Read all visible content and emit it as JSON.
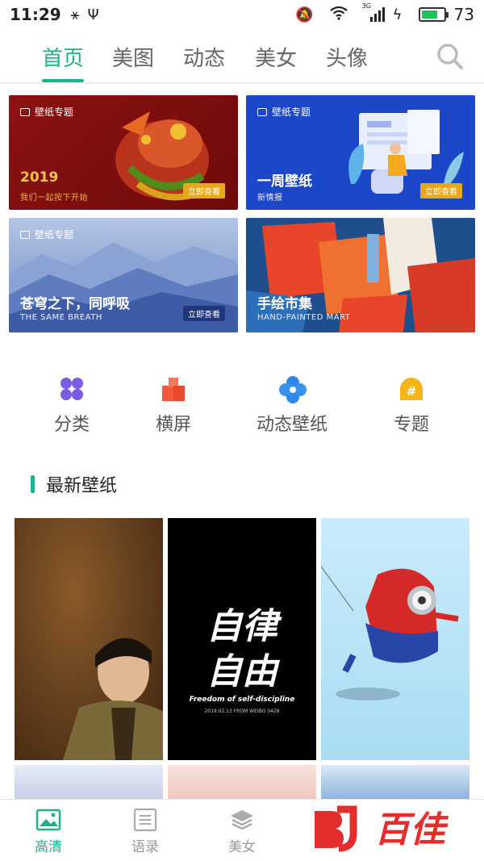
{
  "status_bar": {
    "time": "11:29",
    "network": "3G",
    "battery": "73",
    "battery_level": 0.73
  },
  "top_tabs": [
    {
      "label": "首页",
      "active": true
    },
    {
      "label": "美图",
      "active": false
    },
    {
      "label": "动态",
      "active": false
    },
    {
      "label": "美女",
      "active": false
    },
    {
      "label": "头像",
      "active": false
    }
  ],
  "banners": [
    {
      "tag": "壁纸专题",
      "title": "2019",
      "subtitle": "我们一起按下开始",
      "button": "立即查看"
    },
    {
      "tag": "壁纸专题",
      "title": "一周壁纸",
      "subtitle": "新情报",
      "button": "立即查看"
    },
    {
      "tag": "壁纸专题",
      "title": "苍穹之下，同呼吸",
      "subtitle": "THE SAME BREATH",
      "button": "立即查看"
    },
    {
      "title": "手绘市集",
      "subtitle": "HAND-PAINTED MART"
    }
  ],
  "categories": [
    {
      "label": "分类",
      "icon": "grid-icon",
      "color": "#7b5be0"
    },
    {
      "label": "横屏",
      "icon": "landscape-icon",
      "color": "#f05a3a"
    },
    {
      "label": "动态壁纸",
      "icon": "flower-icon",
      "color": "#2f86e8"
    },
    {
      "label": "专题",
      "icon": "hashtag-icon",
      "color": "#f5b518"
    }
  ],
  "section": {
    "title": "最新壁纸"
  },
  "wallpapers": [
    {
      "kind": "portrait"
    },
    {
      "kind": "text",
      "line1": "自律",
      "line2": "自由",
      "caption": "Freedom of self-discipline",
      "small": "2019.02.13 FROM WEIBO 0428"
    },
    {
      "kind": "cartoon"
    }
  ],
  "bottom_nav": [
    {
      "label": "高清",
      "icon": "image-icon",
      "active": true
    },
    {
      "label": "语录",
      "icon": "list-icon",
      "active": false
    },
    {
      "label": "美女",
      "icon": "layers-icon",
      "active": false
    }
  ],
  "watermark": {
    "text": "百佳"
  },
  "colors": {
    "accent": "#1fb28a"
  }
}
